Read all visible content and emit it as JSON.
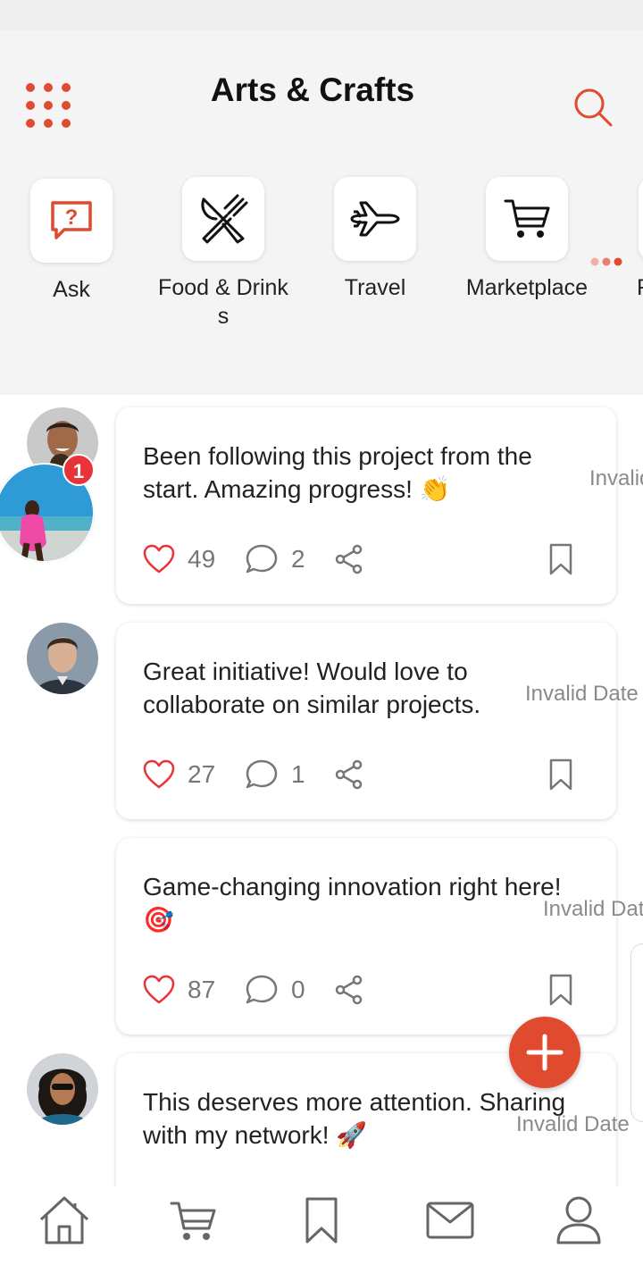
{
  "header": {
    "title": "Arts & Crafts",
    "menu_icon": "grid-dots-icon",
    "search_icon": "search-icon"
  },
  "categories": [
    {
      "label": "Ask",
      "icon": "question-chat-icon"
    },
    {
      "label": "Food & Drinks",
      "icon": "fork-knife-icon"
    },
    {
      "label": "Travel",
      "icon": "airplane-icon"
    },
    {
      "label": "Marketplace",
      "icon": "cart-icon"
    }
  ],
  "posts": [
    {
      "text": "Been following this project from the start. Amazing progress! 👏",
      "date": "Invalid Date",
      "likes": "49",
      "comments": "2"
    },
    {
      "text": "Great initiative! Would love to collaborate on similar projects.",
      "date": "Invalid Date",
      "likes": "27",
      "comments": "1"
    },
    {
      "text": "Game-changing innovation right here! 🎯",
      "date": "Invalid Date",
      "likes": "87",
      "comments": "0"
    },
    {
      "text": "This deserves more attention. Sharing with my network! 🚀",
      "date": "Invalid Date",
      "likes": "",
      "comments": ""
    }
  ],
  "story": {
    "badge_count": "1"
  },
  "bottom_nav": [
    {
      "icon": "home-icon"
    },
    {
      "icon": "cart-icon"
    },
    {
      "icon": "bookmark-icon"
    },
    {
      "icon": "mail-icon"
    },
    {
      "icon": "profile-icon"
    }
  ],
  "colors": {
    "accent": "#e04a2f",
    "heart": "#e8333a",
    "badge": "#e8333a"
  }
}
